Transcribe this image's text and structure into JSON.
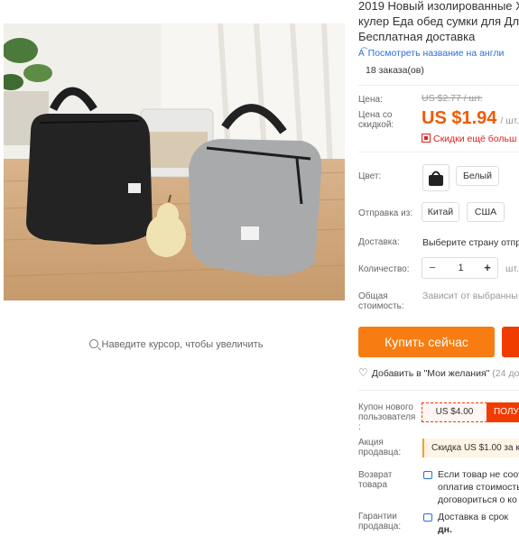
{
  "gallery": {
    "zoom_hint": "Наведите курсор, чтобы увеличить"
  },
  "product": {
    "title_lines": [
      "2019 Новый изолированные X",
      "кулер Еда обед сумки для Для",
      "Бесплатная доставка"
    ],
    "translate_link": "Посмотреть название на англи",
    "orders": "18 заказа(ов)"
  },
  "pricing": {
    "price_label": "Цена:",
    "old_price": "US $2.77 / шт.",
    "discount_label_line1": "Цена со",
    "discount_label_line2": "скидкой:",
    "price": "US $1.94",
    "per_unit": "/ шт.",
    "app_discount": "Скидки ещё больш"
  },
  "options": {
    "color_label": "Цвет:",
    "color_value": "Белый",
    "ship_from_label": "Отправка из:",
    "ship_from": [
      "Китай",
      "США"
    ],
    "delivery_label": "Доставка:",
    "delivery_value": "Выберите страну отпр",
    "quantity_label": "Количество:",
    "quantity": "1",
    "quantity_unit": "шт.",
    "total_label_line1": "Общая",
    "total_label_line2": "стоимость:",
    "total_value": "Зависит от выбранны"
  },
  "actions": {
    "buy_now": "Купить сейчас",
    "wishlist": "Добавить в \"Мои желания\"",
    "wishlist_count": "(24 до"
  },
  "coupons": {
    "new_user_label_lines": [
      "Купон нового",
      "пользователя",
      ":"
    ],
    "new_user_value": "US $4.00",
    "new_user_button": "ПОЛУ",
    "seller_label_lines": [
      "Акция",
      "продавца:"
    ],
    "seller_promo": "Скидка US $1.00 за к"
  },
  "returns": {
    "label_lines": [
      "Возврат",
      "товара"
    ],
    "text_lines": [
      "Если товар не соот",
      "оплатив стоимость",
      "договориться о ко"
    ]
  },
  "guarantees": {
    "label_lines": [
      "Гарантии",
      "продавца:"
    ],
    "text_lines": [
      "Доставка в срок",
      "дн."
    ]
  },
  "colors": {
    "accent": "#f77d12",
    "price": "#f05a00",
    "link": "#2a6fdb",
    "alert": "#e02020"
  }
}
